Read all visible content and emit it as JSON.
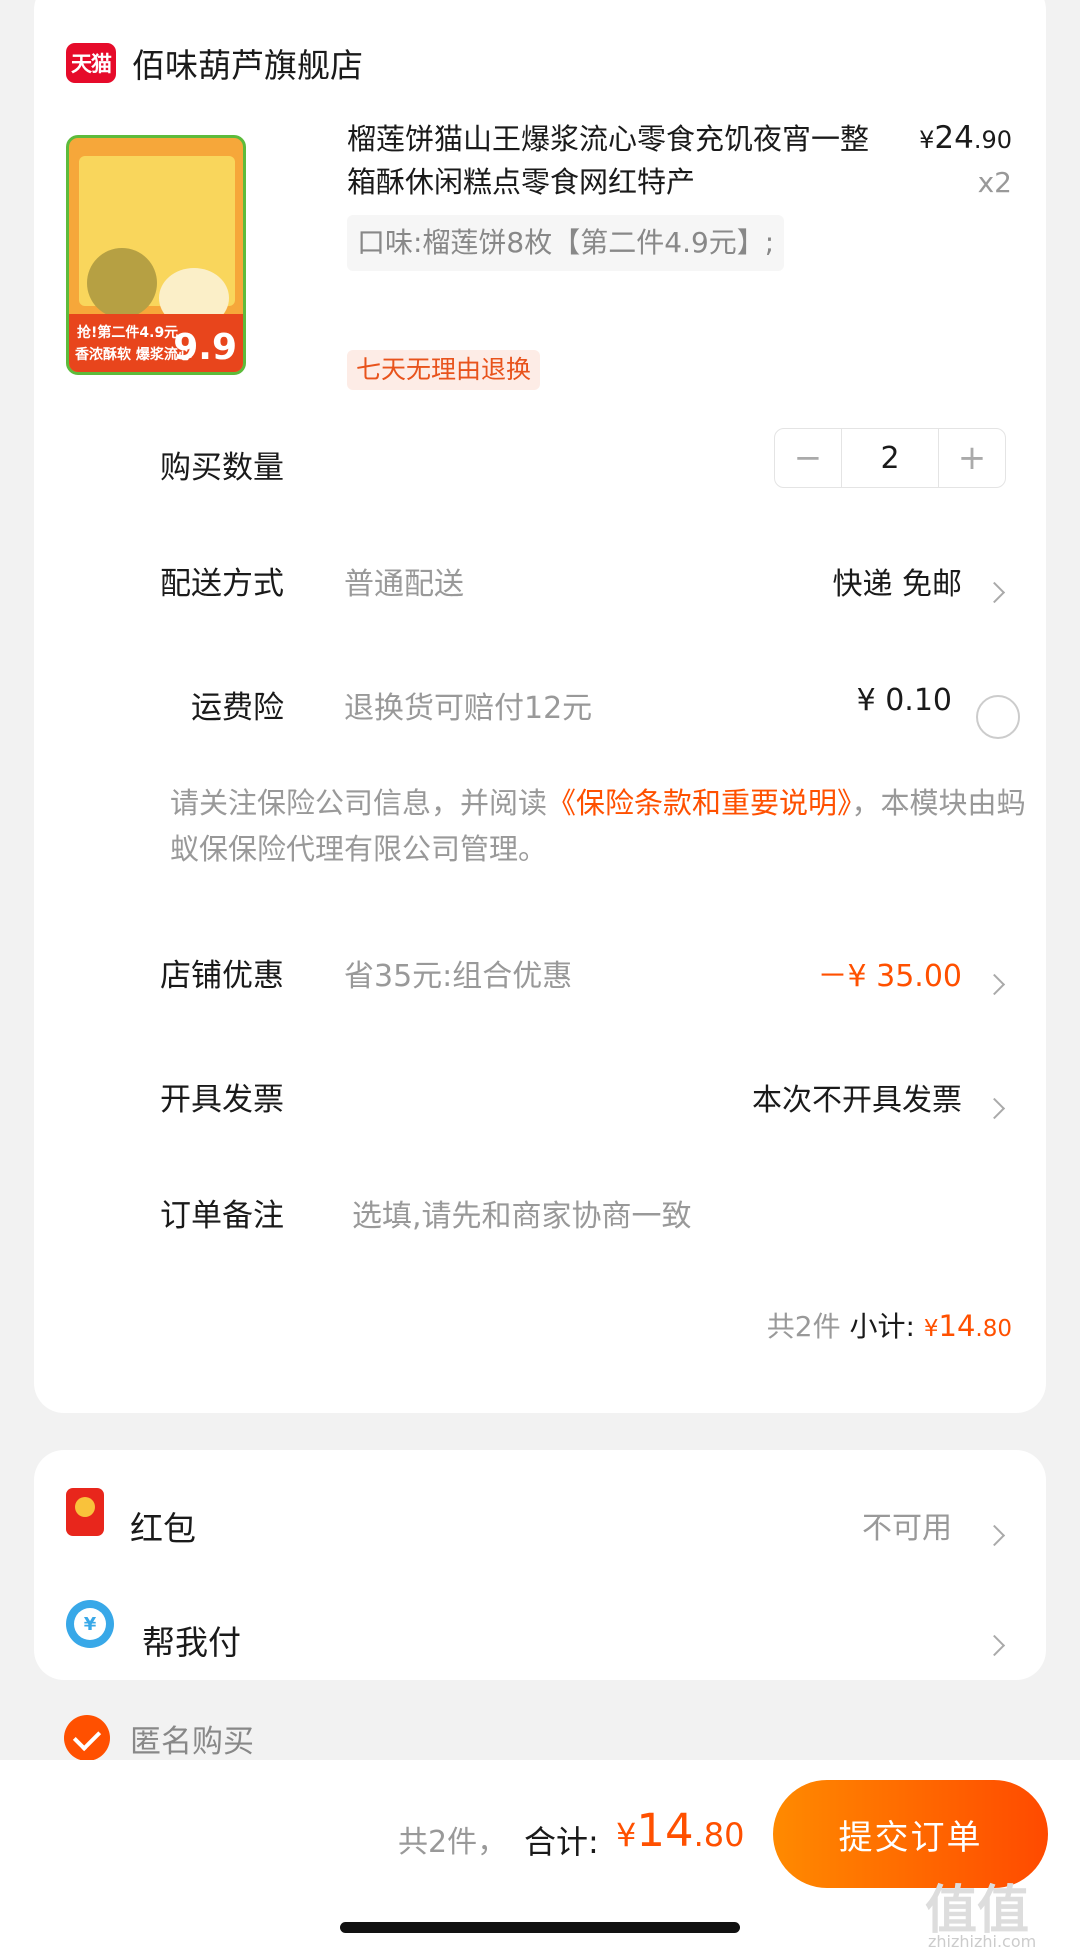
{
  "shop": {
    "badge": "天猫",
    "name": "佰味葫芦旗舰店"
  },
  "product": {
    "title": "榴莲饼猫山王爆浆流心零食充饥夜宵一整箱酥休闲糕点零食网红特产",
    "price_symbol": "¥",
    "price_int": "24",
    "price_dec": ".90",
    "quantity_tag": "x2",
    "sku": "口味:榴莲饼8枚【第二件4.9元】;",
    "return_tag": "七天无理由退换",
    "image_texts": {
      "banner1": "抢!第二件4.9元",
      "banner2": "香浓酥软 爆浆流心",
      "price": "9.9"
    }
  },
  "quantity": {
    "label": "购买数量",
    "value": "2",
    "minus": "−",
    "plus": "+"
  },
  "delivery": {
    "label": "配送方式",
    "sub": "普通配送",
    "value": "快递 免邮"
  },
  "insurance": {
    "label": "运费险",
    "sub": "退换货可赔付12元",
    "value": "¥ 0.10"
  },
  "notice": {
    "pre": "请关注保险公司信息，并阅读",
    "link": "《保险条款和重要说明》",
    "post": "，本模块由蚂蚁保保险代理有限公司管理。"
  },
  "discount": {
    "label": "店铺优惠",
    "sub": "省35元:组合优惠",
    "value": "－¥ 35.00"
  },
  "invoice": {
    "label": "开具发票",
    "value": "本次不开具发票"
  },
  "remark": {
    "label": "订单备注",
    "placeholder": "选填,请先和商家协商一致"
  },
  "subtotal": {
    "count": "共2件",
    "label": "小计:",
    "symbol": "¥",
    "int": "14",
    "dec": ".80"
  },
  "redpacket": {
    "label": "红包",
    "value": "不可用"
  },
  "helppay": {
    "label": "帮我付",
    "icon_char": "¥"
  },
  "anonymous": {
    "label": "匿名购买"
  },
  "footer": {
    "count": "共2件，",
    "label": "合计:",
    "symbol": "¥",
    "int": "14",
    "dec": ".80",
    "submit": "提交订单",
    "watermark": "值值值",
    "watermark_url": "zhizhizhi.com"
  },
  "colors": {
    "accent": "#ff5000",
    "tmall": "#e60b2a",
    "page_bg": "#f2f2f2"
  }
}
